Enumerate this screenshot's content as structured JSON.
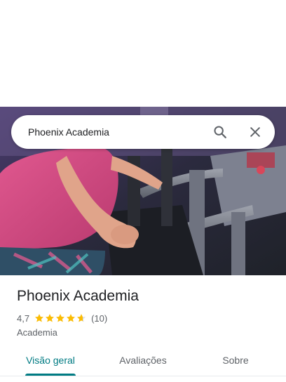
{
  "search": {
    "query": "Phoenix Academia",
    "search_icon": "search-icon",
    "close_icon": "close-icon"
  },
  "place": {
    "name": "Phoenix Academia",
    "rating": "4,7",
    "stars": 4.7,
    "review_count": "(10)",
    "category": "Academia"
  },
  "tabs": [
    {
      "label": "Visão geral",
      "active": true
    },
    {
      "label": "Avaliações",
      "active": false
    },
    {
      "label": "Sobre",
      "active": false
    }
  ],
  "colors": {
    "accent": "#007b83",
    "star": "#fbbc04",
    "text_primary": "#202124",
    "text_secondary": "#5f6368"
  }
}
